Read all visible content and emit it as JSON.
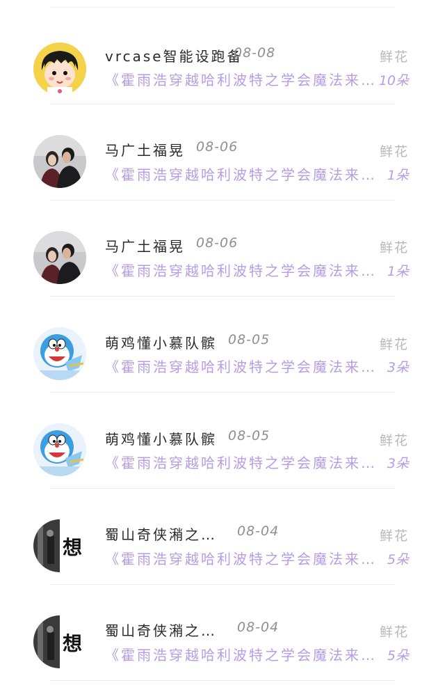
{
  "items": [
    {
      "name": "vrcase智能设跑备",
      "date": "08-08",
      "message": "《霍雨浩穿越哈利波特之学会魔法来…",
      "gift_label": "鲜花",
      "gift_count": "10朵",
      "avatar": "cartoon-girl-avatar"
    },
    {
      "name": "马广土福晃",
      "date": "08-06",
      "message": "《霍雨浩穿越哈利波特之学会魔法来…",
      "gift_label": "鲜花",
      "gift_count": "1朵",
      "avatar": "couple-photo-avatar"
    },
    {
      "name": "马广土福晃",
      "date": "08-06",
      "message": "《霍雨浩穿越哈利波特之学会魔法来…",
      "gift_label": "鲜花",
      "gift_count": "1朵",
      "avatar": "couple-photo-avatar"
    },
    {
      "name": "萌鸡懂小慕队髌",
      "date": "08-05",
      "message": "《霍雨浩穿越哈利波特之学会魔法来…",
      "gift_label": "鲜花",
      "gift_count": "3朵",
      "avatar": "doraemon-avatar"
    },
    {
      "name": "萌鸡懂小慕队髌",
      "date": "08-05",
      "message": "《霍雨浩穿越哈利波特之学会魔法来…",
      "gift_label": "鲜花",
      "gift_count": "3朵",
      "avatar": "doraemon-avatar"
    },
    {
      "name": "蜀山奇侠潲之…",
      "date": "08-04",
      "message": "《霍雨浩穿越哈利波特之学会魔法来…",
      "gift_label": "鲜花",
      "gift_count": "5朵",
      "avatar": "think-text-avatar",
      "avatar_text": "想"
    },
    {
      "name": "蜀山奇侠潲之…",
      "date": "08-04",
      "message": "《霍雨浩穿越哈利波特之学会魔法来…",
      "gift_label": "鲜花",
      "gift_count": "5朵",
      "avatar": "think-text-avatar",
      "avatar_text": "想"
    }
  ]
}
